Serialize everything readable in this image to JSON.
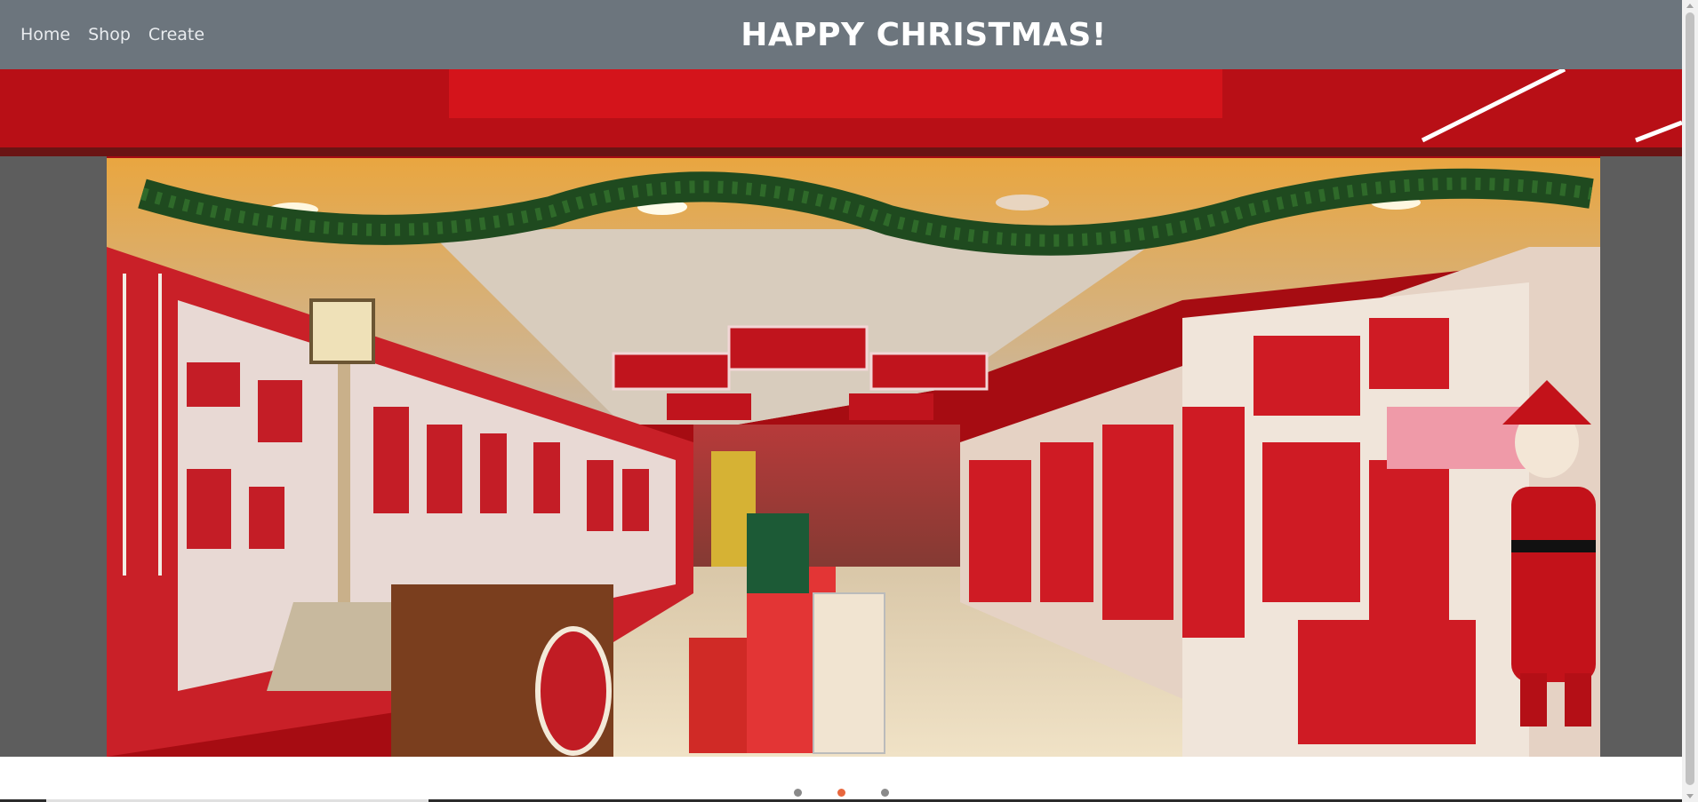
{
  "nav": {
    "links": [
      "Home",
      "Shop",
      "Create"
    ],
    "title": "HAPPY CHRISTMAS!"
  },
  "carousel": {
    "image": "christmas-shop-interior",
    "slide_count": 3,
    "active_index": 1
  },
  "colors": {
    "navbar": "#6c757d",
    "title": "#ffffff",
    "active_dot": "#e8673e",
    "inactive_dot": "#8a8a8a"
  }
}
